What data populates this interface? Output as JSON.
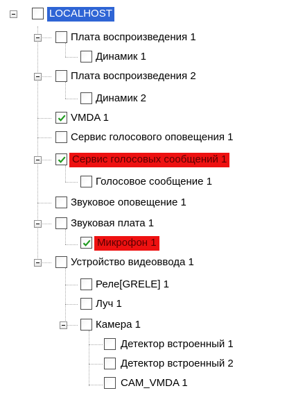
{
  "tree": {
    "root": {
      "label": "LOCALHOST",
      "checked": false,
      "expanded": true
    },
    "items": [
      {
        "label": "Плата воспроизведения 1",
        "checked": false,
        "expanded": true
      },
      {
        "label": "Динамик 1",
        "checked": false
      },
      {
        "label": "Плата воспроизведения 2",
        "checked": false,
        "expanded": true
      },
      {
        "label": "Динамик 2",
        "checked": false
      },
      {
        "label": "VMDA 1",
        "checked": true
      },
      {
        "label": "Сервис голосового оповещения 1",
        "checked": false
      },
      {
        "label": "Сервис голосовых сообщений 1",
        "checked": true,
        "expanded": true,
        "highlight": "red"
      },
      {
        "label": "Голосовое сообщение 1",
        "checked": false
      },
      {
        "label": "Звуковое оповещение 1",
        "checked": false
      },
      {
        "label": "Звуковая плата 1",
        "checked": false,
        "expanded": true
      },
      {
        "label": "Микрофон 1",
        "checked": true,
        "highlight": "red"
      },
      {
        "label": "Устройство видеоввода 1",
        "checked": false,
        "expanded": true
      },
      {
        "label": "Реле[GRELE] 1",
        "checked": false
      },
      {
        "label": "Луч 1",
        "checked": false
      },
      {
        "label": "Камера 1",
        "checked": false,
        "expanded": true
      },
      {
        "label": "Детектор встроенный 1",
        "checked": false
      },
      {
        "label": "Детектор встроенный 2",
        "checked": false
      },
      {
        "label": "CAM_VMDA 1",
        "checked": false
      }
    ]
  },
  "colors": {
    "selection": "#2f65d5",
    "error_highlight": "#ee1111",
    "checkmark": "#1f9a1f"
  },
  "icons": {
    "expander": "minus-box-icon",
    "check": "green-check-icon"
  }
}
